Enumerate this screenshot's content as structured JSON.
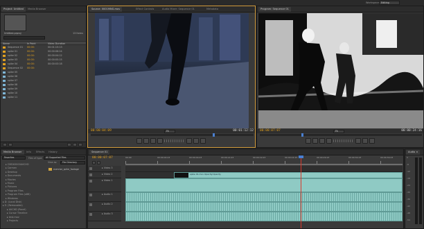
{
  "app": {
    "workspace_label": "Workspace:",
    "workspace_value": "Editing"
  },
  "project_panel": {
    "tabs": [
      "Project: Untitled",
      "Media Browser"
    ],
    "title": "Untitled.prproj",
    "items_count": "13 Items",
    "columns": [
      "Name",
      "In Point",
      "Video Duration"
    ],
    "rows": [
      {
        "name": "Sequence 01",
        "in": "00:00:",
        "dur": "00:01:15:13",
        "color": "#e2a11f"
      },
      {
        "name": "spike 01",
        "in": "00:00:",
        "dur": "00:00:06:24",
        "color": "#e2a11f"
      },
      {
        "name": "spike 02",
        "in": "00:00:",
        "dur": "00:00:04:12",
        "color": "#e2a11f"
      },
      {
        "name": "spike 03",
        "in": "00:00:",
        "dur": "00:00:05:15",
        "color": "#e2a11f"
      },
      {
        "name": "spike 04",
        "in": "00:00:",
        "dur": "00:00:03:18",
        "color": "#e2a11f"
      },
      {
        "name": "Sequence 02",
        "in": "00:00:",
        "dur": "",
        "color": "#e2a11f"
      },
      {
        "name": "spike 05",
        "in": "",
        "dur": "",
        "color": "#7fb6d6"
      },
      {
        "name": "spike 06",
        "in": "",
        "dur": "",
        "color": "#7fb6d6"
      },
      {
        "name": "spike 07",
        "in": "",
        "dur": "",
        "color": "#7fb6d6"
      },
      {
        "name": "spike 08",
        "in": "",
        "dur": "",
        "color": "#7fb6d6"
      },
      {
        "name": "spike 09",
        "in": "",
        "dur": "",
        "color": "#7fb6d6"
      },
      {
        "name": "spike 10",
        "in": "",
        "dur": "",
        "color": "#7fb6d6"
      },
      {
        "name": "spike 11",
        "in": "",
        "dur": "",
        "color": "#7fb6d6"
      }
    ]
  },
  "source_monitor": {
    "tabs": [
      "Source: 0001MNG.mov",
      "Effect Controls",
      "Audio Mixer: Sequence 01",
      "Metadata"
    ],
    "timecode_in": "00:00:04:09",
    "fit": "Fit",
    "timecode_dur": "00:01:12:12"
  },
  "program_monitor": {
    "tabs": [
      "Program: Sequence 01"
    ],
    "timecode_in": "00:00:07:07",
    "fit": "Fit",
    "timecode_dur": "00:00:24:16"
  },
  "media_browser": {
    "tabs": [
      "Media Browser",
      "Info",
      "Effects",
      "History"
    ],
    "files_of_type_label": "Files of type:",
    "files_of_type_value": "All Supported Files",
    "view_as_label": "View as:",
    "view_as_value": "File Directory",
    "favorites": "Favorites",
    "tree": [
      "CMDX0000AVCHD",
      "Carmen",
      "Desktop",
      "Documents",
      "Movies",
      "Music",
      "Pictures",
      "Program Files",
      "Program Files (x86)",
      "Windows",
      "D: (Local Disk)",
      "E: (Removable)",
      "AVCHD (Panel)",
      "Cursor Timeline",
      "test.mov",
      "Projects"
    ],
    "file_name": "exercise_spike_footage"
  },
  "timeline": {
    "tab": "Sequence 01",
    "timecode": "00:00:07:07",
    "ruler_ticks": [
      "00:00",
      "00:00:04:23",
      "00:00:09:23",
      "00:00:14:23",
      "00:00:19:23",
      "00:00:24:23",
      "00:00:29:23",
      "00:00:34:23",
      "00:00:39:23"
    ],
    "tracks": [
      {
        "name": "Video 3",
        "type": "video"
      },
      {
        "name": "Video 2",
        "type": "video"
      },
      {
        "name": "Video 1",
        "type": "video"
      },
      {
        "name": "Audio 1",
        "type": "audio"
      },
      {
        "name": "Audio 2",
        "type": "audio"
      },
      {
        "name": "Audio 3",
        "type": "audio"
      }
    ],
    "clip_label": "spike 01.mov",
    "clip_label_opacity": "Opacity:Opacity"
  },
  "audio_meter": {
    "tab": "Audio ×",
    "scale": [
      "0",
      "-6",
      "-12",
      "-18",
      "-24",
      "-30",
      "-36",
      "-42",
      "-48",
      "-54"
    ]
  },
  "colors": {
    "timecode_orange": "#e2a11f",
    "clip_teal": "#8fcac4",
    "playhead_red": "#d9372b",
    "panel_bg": "#3a3a3a"
  }
}
